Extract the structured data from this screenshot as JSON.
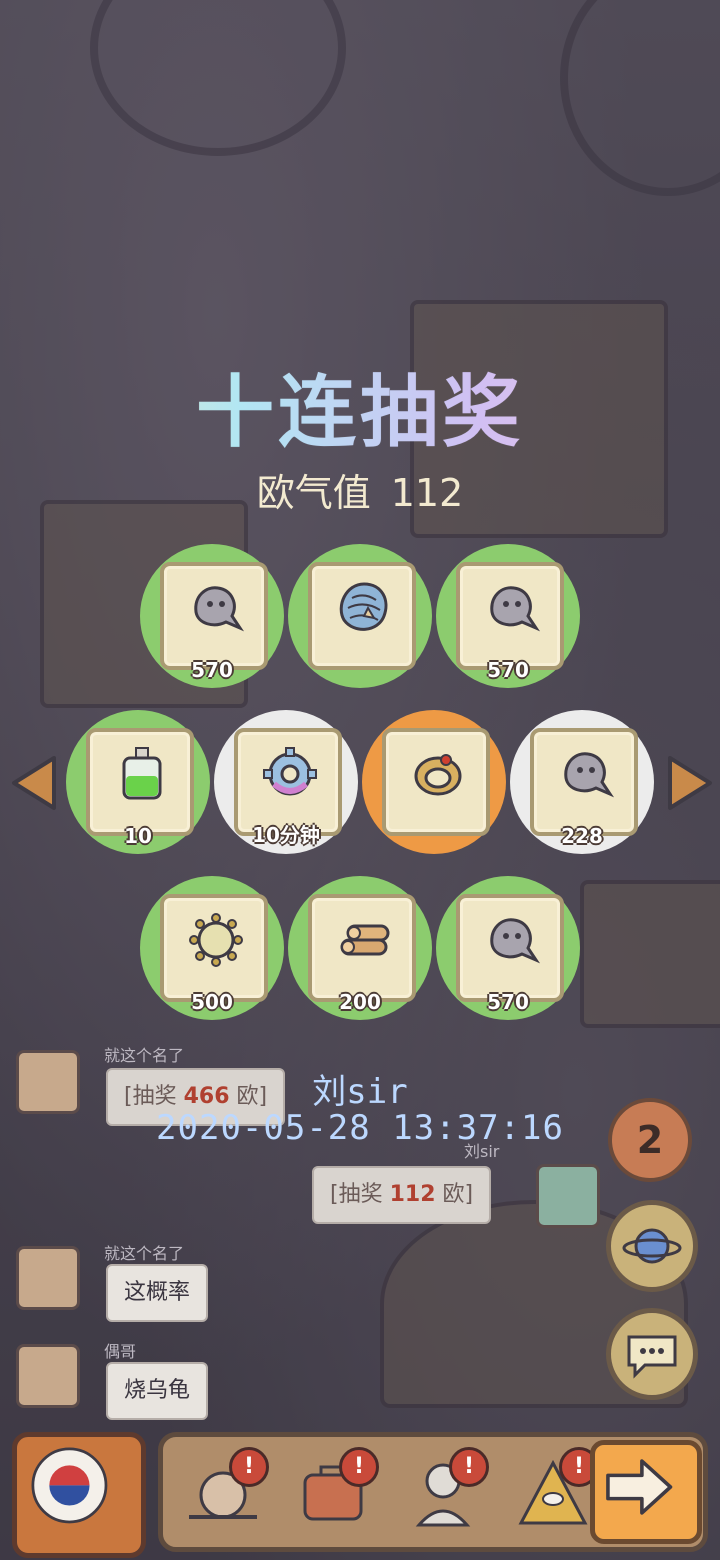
{
  "draw": {
    "title": "十连抽奖",
    "luck_label": "欧气值",
    "luck_value": "112"
  },
  "rewards": [
    {
      "qty": "570",
      "item": "ghost-icon",
      "bg": "green"
    },
    {
      "qty": "",
      "item": "shell-icon",
      "bg": "green"
    },
    {
      "qty": "570",
      "item": "ghost-icon",
      "bg": "green"
    },
    {
      "qty": "10",
      "item": "potion-icon",
      "bg": "green"
    },
    {
      "qty": "10分钟",
      "item": "gear-icon",
      "bg": "white"
    },
    {
      "qty": "",
      "item": "ring-icon",
      "bg": "orange"
    },
    {
      "qty": "228",
      "item": "ghost-icon",
      "bg": "white"
    },
    {
      "qty": "500",
      "item": "virus-icon",
      "bg": "green"
    },
    {
      "qty": "200",
      "item": "wood-icon",
      "bg": "green"
    },
    {
      "qty": "570",
      "item": "ghost-icon",
      "bg": "green"
    }
  ],
  "chat": {
    "msg1": {
      "name": "就这个名了",
      "prefix": "[抽奖 ",
      "value": "466",
      "suffix": " 欧]"
    },
    "overlay_user": "刘sir",
    "overlay_time": "2020-05-28 13:37:16",
    "msg2": {
      "name": "刘sir",
      "prefix": "[抽奖 ",
      "value": "112",
      "suffix": " 欧]"
    },
    "msg3": {
      "name": "就这个名了",
      "text": "这概率"
    },
    "msg4": {
      "name": "偶哥",
      "text": "烧乌龟"
    }
  },
  "side": {
    "badge": "2"
  },
  "bottom": {
    "alert": "!"
  },
  "colors": {
    "green": "#8ccc6e",
    "white": "#ececec",
    "orange": "#ee9a45",
    "user_text": "#bcd8ff",
    "highlight": "#b04030"
  }
}
